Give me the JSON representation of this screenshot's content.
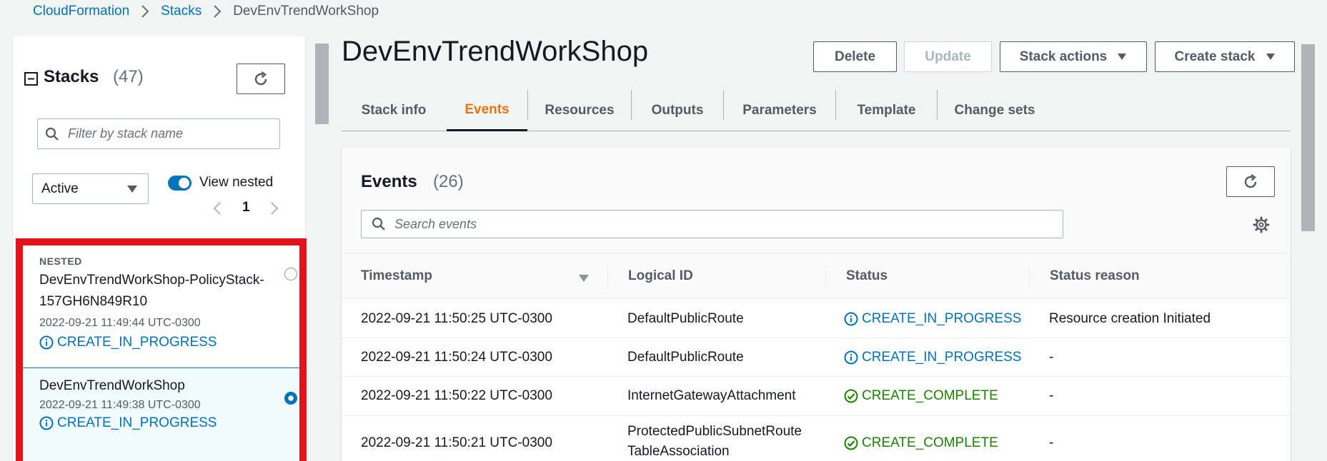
{
  "breadcrumb": {
    "root": "CloudFormation",
    "section": "Stacks",
    "current": "DevEnvTrendWorkShop"
  },
  "sidebar": {
    "title": "Stacks",
    "count": "(47)",
    "search_placeholder": "Filter by stack name",
    "filter_value": "Active",
    "view_nested_label": "View nested",
    "view_nested_enabled": true,
    "page": "1",
    "stacks": [
      {
        "nested_tag": "NESTED",
        "name": "DevEnvTrendWorkShop-PolicyStack-157GH6N849R10",
        "time": "2022-09-21 11:49:44 UTC-0300",
        "status": "CREATE_IN_PROGRESS",
        "selected": false
      },
      {
        "nested_tag": "",
        "name": "DevEnvTrendWorkShop",
        "time": "2022-09-21 11:49:38 UTC-0300",
        "status": "CREATE_IN_PROGRESS",
        "selected": true
      }
    ]
  },
  "main": {
    "title": "DevEnvTrendWorkShop",
    "buttons": {
      "delete": "Delete",
      "update": "Update",
      "stack_actions": "Stack actions",
      "create_stack": "Create stack"
    },
    "tabs": [
      "Stack info",
      "Events",
      "Resources",
      "Outputs",
      "Parameters",
      "Template",
      "Change sets"
    ],
    "active_tab": "Events",
    "events": {
      "title": "Events",
      "count": "(26)",
      "search_placeholder": "Search events",
      "columns": [
        "Timestamp",
        "Logical ID",
        "Status",
        "Status reason"
      ],
      "rows": [
        {
          "timestamp": "2022-09-21 11:50:25 UTC-0300",
          "logical_id": "DefaultPublicRoute",
          "status": "CREATE_IN_PROGRESS",
          "reason": "Resource creation Initiated"
        },
        {
          "timestamp": "2022-09-21 11:50:24 UTC-0300",
          "logical_id": "DefaultPublicRoute",
          "status": "CREATE_IN_PROGRESS",
          "reason": "-"
        },
        {
          "timestamp": "2022-09-21 11:50:22 UTC-0300",
          "logical_id": "InternetGatewayAttachment",
          "status": "CREATE_COMPLETE",
          "reason": "-"
        },
        {
          "timestamp": "2022-09-21 11:50:21 UTC-0300",
          "logical_id_line1": "ProtectedPublicSubnetRoute",
          "logical_id_line2": "TableAssociation",
          "status": "CREATE_COMPLETE",
          "reason": "-"
        }
      ]
    }
  },
  "colors": {
    "link": "#0073bb",
    "in_progress": "#0073bb",
    "complete": "#1d8102",
    "active_tab": "#ec7211",
    "highlight_border": "#e1141b"
  }
}
